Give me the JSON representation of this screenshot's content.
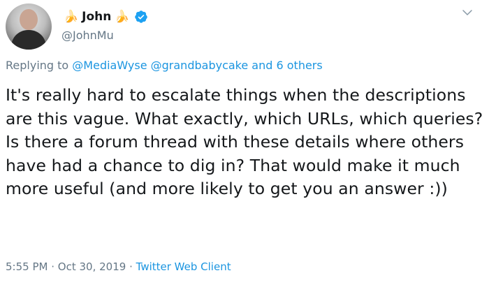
{
  "tweet": {
    "display_name": "John",
    "handle": "@JohnMu",
    "name_emoji": "🍌",
    "replying_prefix": "Replying to",
    "reply_mentions": [
      "@MediaWyse",
      "@grandbabycake"
    ],
    "reply_others": "and 6 others",
    "text": "It's really hard to escalate things when the descriptions are this vague. What exactly, which URLs, which queries? Is there a forum thread with these details where others have had a chance to dig in? That would make it much more useful  (and more likely to get you an answer :))",
    "time": "5:55 PM",
    "date": "Oct 30, 2019",
    "separator": "·",
    "source": "Twitter Web Client"
  },
  "colors": {
    "text": "#14171a",
    "muted": "#657786",
    "link": "#1b95e0",
    "verified": "#1da1f2"
  },
  "icons": [
    "avatar",
    "banana-emoji",
    "verified-badge-icon",
    "chevron-down-icon"
  ]
}
